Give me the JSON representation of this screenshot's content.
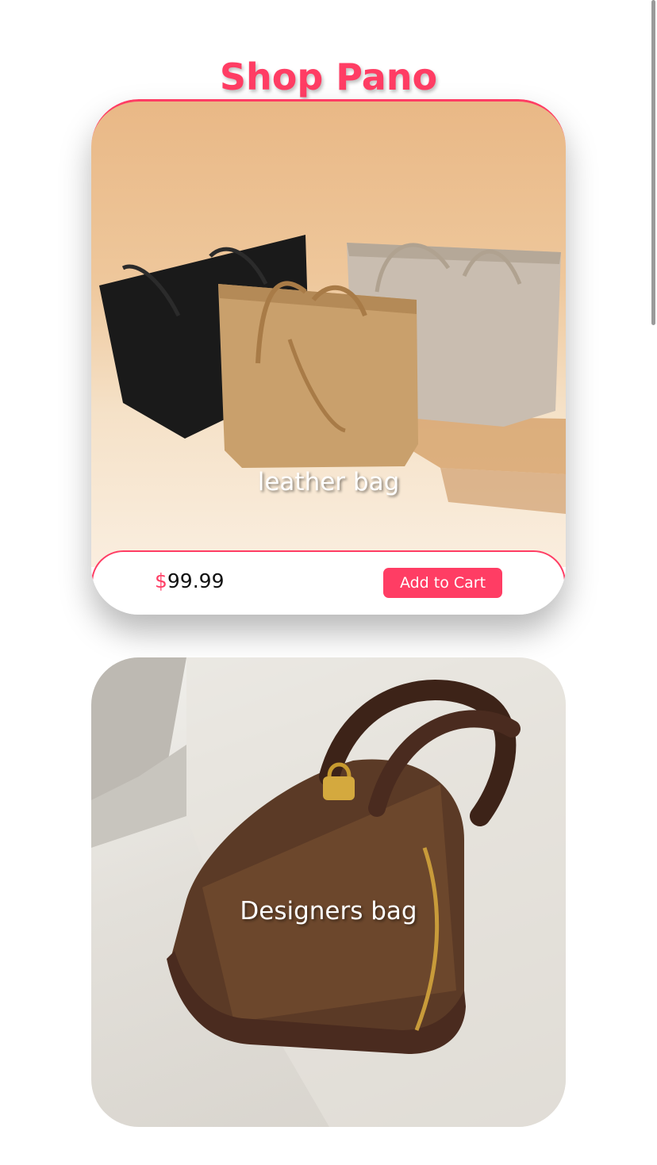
{
  "header": {
    "title": "Shop Pano"
  },
  "products": [
    {
      "caption": "leather bag",
      "currency": "$",
      "price": "99.99",
      "button_label": "Add to Cart"
    },
    {
      "caption": "Designers bag"
    }
  ],
  "colors": {
    "accent": "#ff3d64",
    "background": "#ffffff"
  }
}
